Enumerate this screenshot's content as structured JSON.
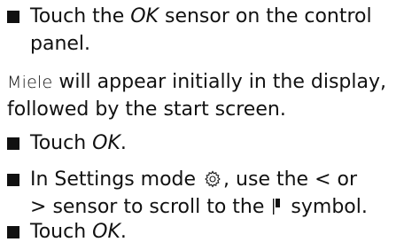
{
  "steps": [
    {
      "line1_pre": "Touch the ",
      "line1_em": "OK",
      "line1_post": " sensor on the control",
      "line2": "panel."
    },
    {
      "pre": "Touch ",
      "em": "OK",
      "post": "."
    },
    {
      "line1_pre": "In Settings mode",
      "line1_mid": ", use the",
      "line1_lt": "<",
      "line1_or": "or",
      "line2_gt": ">",
      "line2_mid": "sensor to scroll to the",
      "line2_post": "symbol."
    },
    {
      "pre": "Touch ",
      "em": "OK",
      "post": "."
    }
  ],
  "note": {
    "display_word": "Miele",
    "line1_post": " will appear initially in the display,",
    "line2": "followed by the start screen."
  },
  "icons": {
    "bullet": "square-bullet-icon",
    "settings": "gear-icon",
    "symbol": "bar-flag-icon"
  },
  "colors": {
    "text": "#111111",
    "background": "#ffffff"
  }
}
